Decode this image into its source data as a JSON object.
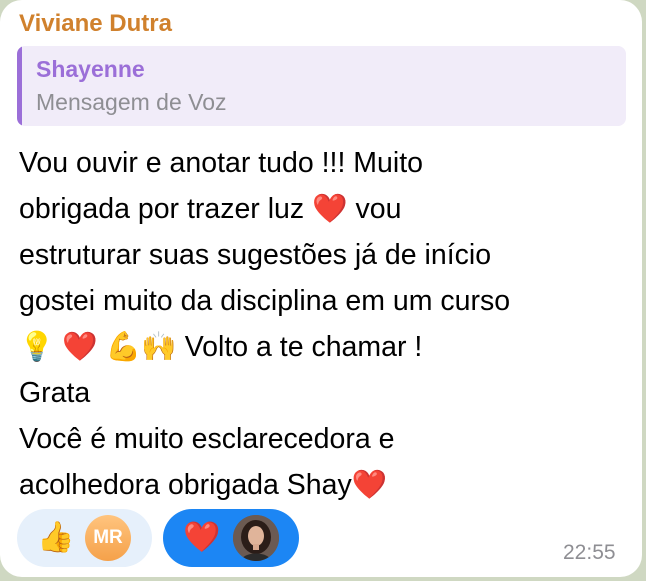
{
  "message": {
    "sender": "Viviane Dutra",
    "reply": {
      "author": "Shayenne",
      "text": "Mensagem de Voz"
    },
    "body_lines": [
      "Vou ouvir e anotar tudo !!! Muito",
      "obrigada por trazer luz ❤️ vou",
      "estruturar suas sugestões já de início",
      "gostei muito da disciplina em um curso",
      "💡 ❤️ 💪🙌 Volto a te chamar !",
      "Grata",
      "Você é muito esclarecedora e",
      "acolhedora obrigada Shay❤️"
    ],
    "time": "22:55",
    "reactions": [
      {
        "emoji": "👍",
        "avatar_initials": "MR",
        "selected": false
      },
      {
        "emoji": "❤️",
        "avatar_icon": "user-photo",
        "selected": true
      }
    ]
  },
  "colors": {
    "sender": "#d0812d",
    "reply_accent": "#9b6fd8",
    "reply_bg": "#f1ecf9",
    "reaction_selected_bg": "#1c86f4",
    "reaction_bg": "#e6f0fb"
  }
}
